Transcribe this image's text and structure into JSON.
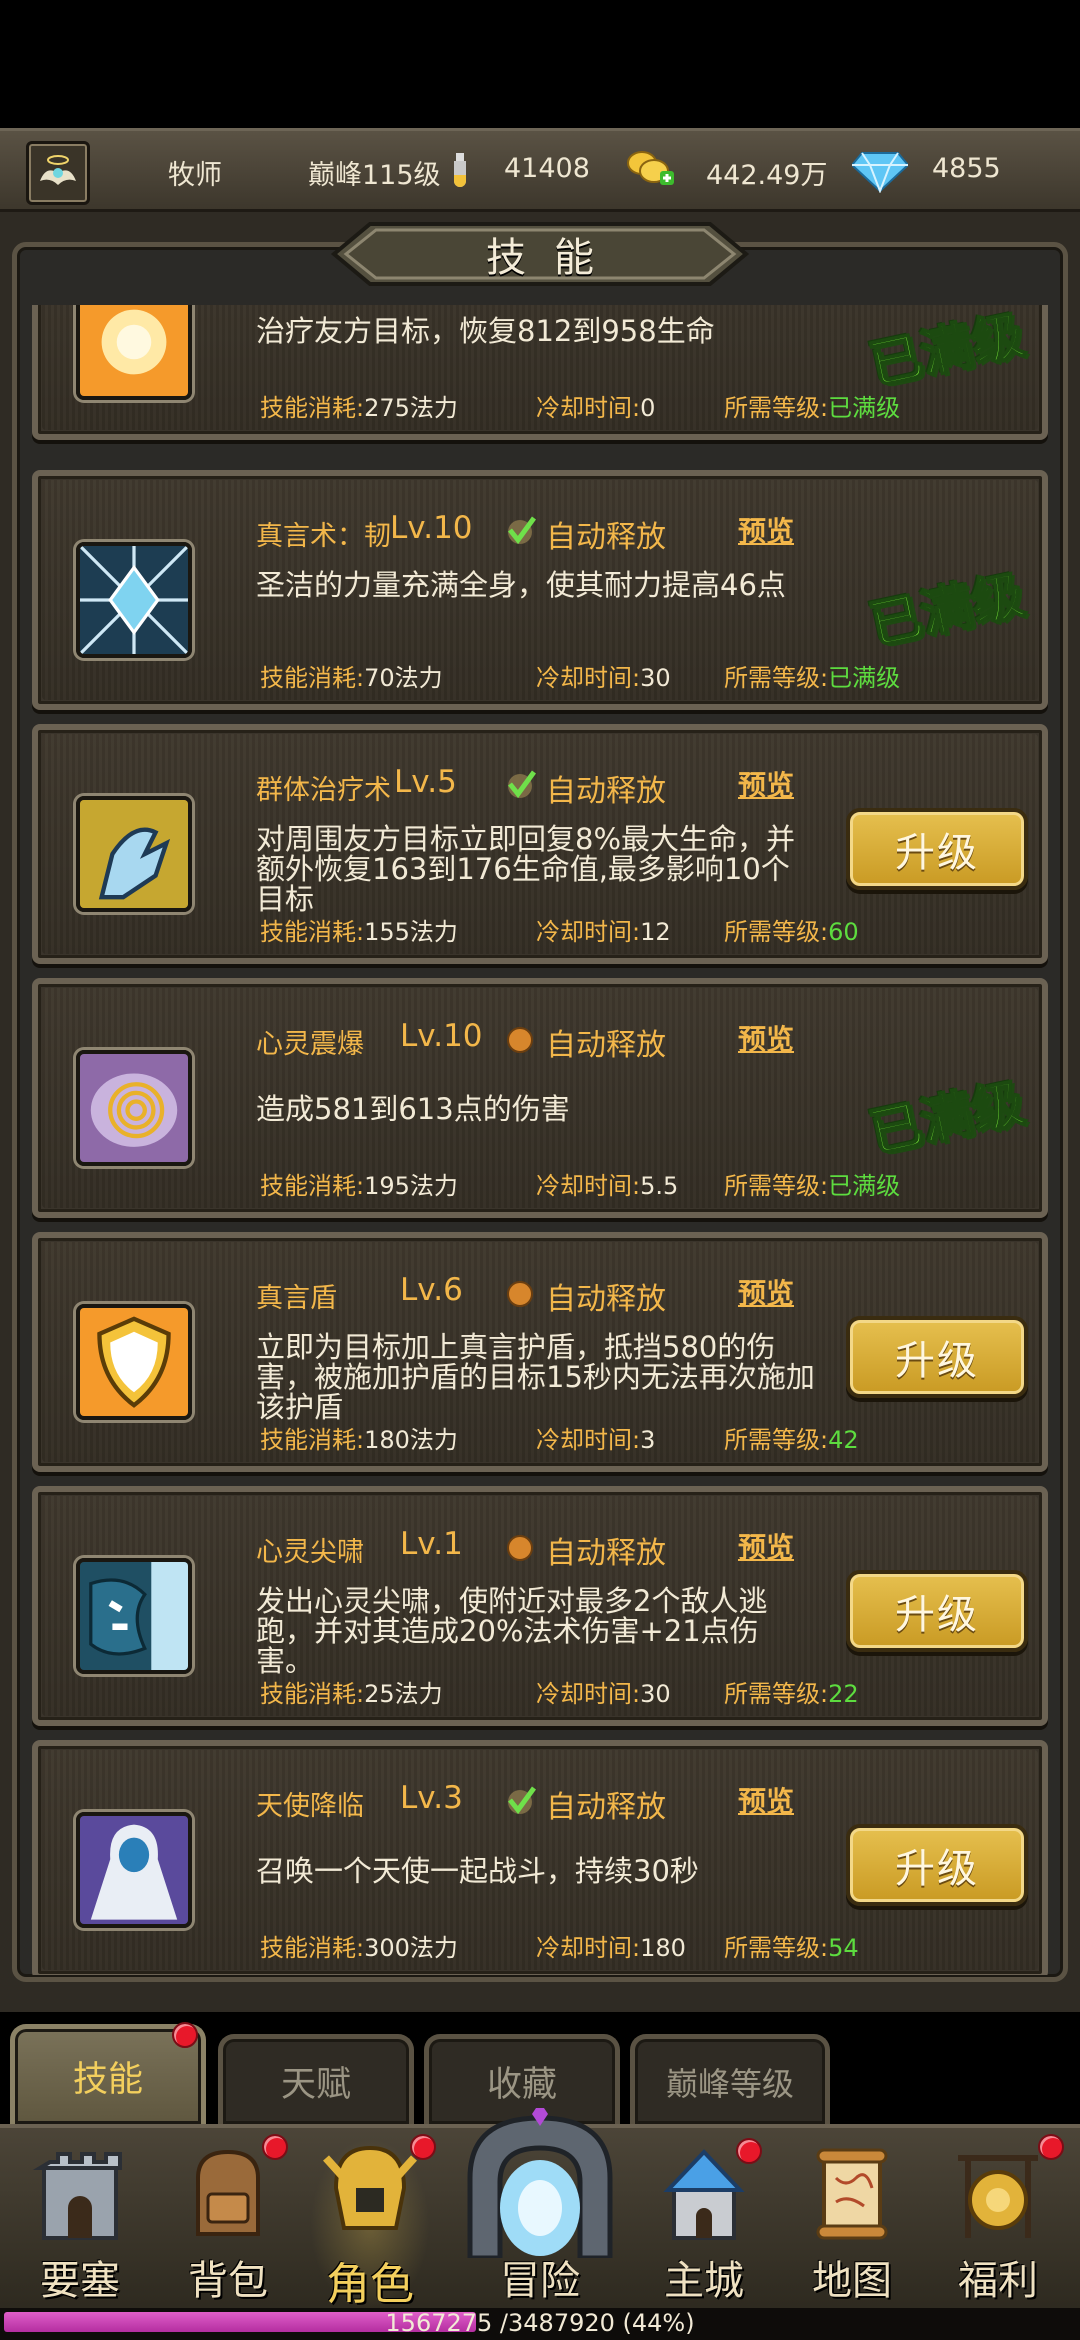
{
  "header": {
    "player_class": "牧师",
    "level_text": "巅峰115级",
    "stamina": "41408",
    "gold": "442.49万",
    "diamonds": "4855"
  },
  "panel": {
    "title": "技能"
  },
  "skills": [
    {
      "name": "",
      "level": "",
      "auto_release": "",
      "preview": "",
      "desc": "治疗友方目标，恢复812到958生命",
      "cost_label": "技能消耗:",
      "cost": "275法力",
      "cd_label": "冷却时间:",
      "cd": "0",
      "req_label": "所需等级:",
      "req": "已满级",
      "status": "已满级"
    },
    {
      "name": "真言术：韧",
      "level": "Lv.10",
      "auto_release": "自动释放",
      "auto_on": true,
      "preview": "预览",
      "desc": "圣洁的力量充满全身，使其耐力提高46点",
      "cost_label": "技能消耗:",
      "cost": "70法力",
      "cd_label": "冷却时间:",
      "cd": "30",
      "req_label": "所需等级:",
      "req": "已满级",
      "status": "已满级"
    },
    {
      "name": "群体治疗术",
      "level": "Lv.5",
      "auto_release": "自动释放",
      "auto_on": true,
      "preview": "预览",
      "desc": "对周围友方目标立即回复8%最大生命，并额外恢复163到176生命值,最多影响10个目标",
      "cost_label": "技能消耗:",
      "cost": "155法力",
      "cd_label": "冷却时间:",
      "cd": "12",
      "req_label": "所需等级:",
      "req": "60",
      "button": "升级"
    },
    {
      "name": "心灵震爆",
      "level": "Lv.10",
      "auto_release": "自动释放",
      "auto_on": false,
      "preview": "预览",
      "desc": "造成581到613点的伤害",
      "cost_label": "技能消耗:",
      "cost": "195法力",
      "cd_label": "冷却时间:",
      "cd": "5.5",
      "req_label": "所需等级:",
      "req": "已满级",
      "status": "已满级"
    },
    {
      "name": "真言盾",
      "level": "Lv.6",
      "auto_release": "自动释放",
      "auto_on": false,
      "preview": "预览",
      "desc": "立即为目标加上真言护盾，抵挡580的伤害，被施加护盾的目标15秒内无法再次施加该护盾",
      "cost_label": "技能消耗:",
      "cost": "180法力",
      "cd_label": "冷却时间:",
      "cd": "3",
      "req_label": "所需等级:",
      "req": "42",
      "button": "升级"
    },
    {
      "name": "心灵尖啸",
      "level": "Lv.1",
      "auto_release": "自动释放",
      "auto_on": false,
      "preview": "预览",
      "desc": "发出心灵尖啸，使附近对最多2个敌人逃跑，并对其造成20%法术伤害+21点伤害。",
      "cost_label": "技能消耗:",
      "cost": "25法力",
      "cd_label": "冷却时间:",
      "cd": "30",
      "req_label": "所需等级:",
      "req": "22",
      "button": "升级"
    },
    {
      "name": "天使降临",
      "level": "Lv.3",
      "auto_release": "自动释放",
      "auto_on": true,
      "preview": "预览",
      "desc": "召唤一个天使一起战斗，持续30秒",
      "cost_label": "技能消耗:",
      "cost": "300法力",
      "cd_label": "冷却时间:",
      "cd": "180",
      "req_label": "所需等级:",
      "req": "54",
      "button": "升级"
    }
  ],
  "tabs": [
    "技能",
    "天赋",
    "收藏",
    "巅峰等级"
  ],
  "nav": [
    "要塞",
    "背包",
    "角色",
    "冒险",
    "主城",
    "地图",
    "福利"
  ],
  "xp": {
    "text": "1567275 /3487920 (44%)",
    "percent": 44
  },
  "colors": {
    "accent_gold": "#f3b74a",
    "maxed_green": "#7cf03a",
    "req_green": "#5ddc3f",
    "badge_red": "#e8182a"
  }
}
